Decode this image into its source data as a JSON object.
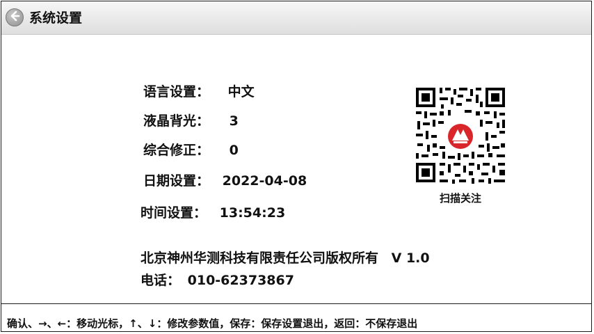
{
  "header": {
    "title": "系统设置",
    "back_icon": "back-arrow-icon"
  },
  "settings": {
    "language": {
      "label": "语言设置：",
      "value": "中文"
    },
    "backlight": {
      "label": "液晶背光：",
      "value": "3"
    },
    "correction": {
      "label": "综合修正：",
      "value": "0"
    },
    "date": {
      "label": "日期设置：",
      "value": "2022-04-08"
    },
    "time": {
      "label": "时间设置：",
      "value": "13:54:23"
    }
  },
  "qr": {
    "caption": "扫描关注",
    "icon": "qr-code-icon",
    "logo_color": "#d8262a"
  },
  "company": {
    "name": "北京神州华测科技有限责任公司版权所有",
    "version": "V 1.0",
    "phone_label": "电话：",
    "phone": "010-62373867"
  },
  "footer": {
    "hint": "确认、→、←：移动光标，↑、↓：修改参数值，保存：保存设置退出，返回：不保存退出"
  }
}
